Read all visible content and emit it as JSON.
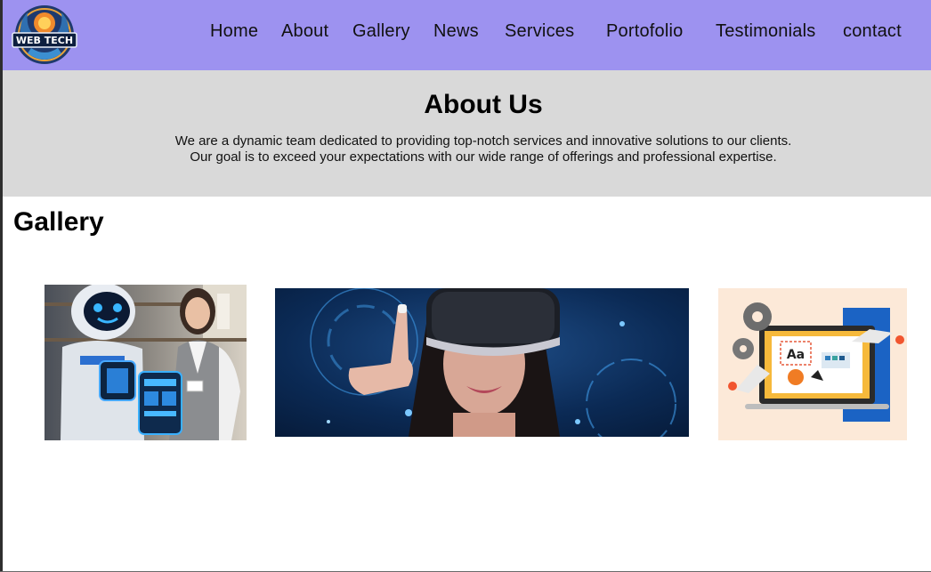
{
  "nav": {
    "logo_text": "WEB TECH",
    "links": [
      "Home",
      "About",
      "Gallery",
      "News",
      "Services",
      "Portofolio",
      "Testimonials",
      "contact"
    ]
  },
  "about": {
    "title": "About Us",
    "line1": "We are a dynamic team dedicated to providing top-notch services and innovative solutions to our clients.",
    "line2": "Our goal is to exceed your expectations with our wide range of offerings and professional expertise."
  },
  "gallery": {
    "title": "Gallery",
    "images": [
      {
        "icon": "robot-and-woman-image"
      },
      {
        "icon": "vr-headset-woman-image"
      },
      {
        "icon": "web-design-laptop-image",
        "badge": "Aa"
      }
    ]
  },
  "colors": {
    "nav_bg": "#9d92f0",
    "about_bg": "#d9d9d9",
    "page_bg": "#ffffff"
  }
}
